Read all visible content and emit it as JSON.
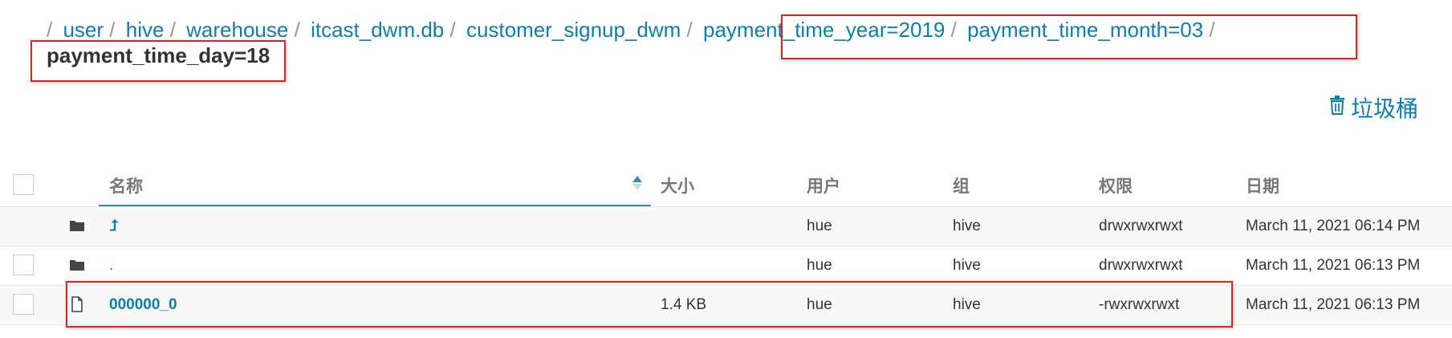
{
  "breadcrumb": {
    "items": [
      "user",
      "hive",
      "warehouse",
      "itcast_dwm.db",
      "customer_signup_dwm",
      "payment_time_year=2019",
      "payment_time_month=03"
    ],
    "separator": "/",
    "current": "payment_time_day=18"
  },
  "toolbar": {
    "trash_label": "垃圾桶",
    "trash_icon": "trash-icon"
  },
  "table": {
    "headers": {
      "name": "名称",
      "size": "大小",
      "user": "用户",
      "group": "组",
      "permissions": "权限",
      "date": "日期"
    },
    "rows": [
      {
        "icon": "folder-icon",
        "name": "⮥",
        "size": "",
        "user": "hue",
        "group": "hive",
        "permissions": "drwxrwxrwxt",
        "date": "March 11, 2021 06:14 PM"
      },
      {
        "icon": "folder-icon",
        "name": ".",
        "size": "",
        "user": "hue",
        "group": "hive",
        "permissions": "drwxrwxrwxt",
        "date": "March 11, 2021 06:13 PM"
      },
      {
        "icon": "file-icon",
        "name": "000000_0",
        "size": "1.4 KB",
        "user": "hue",
        "group": "hive",
        "permissions": "-rwxrwxrwxt",
        "date": "March 11, 2021 06:13 PM"
      }
    ]
  },
  "colors": {
    "link": "#0B7FAD",
    "highlight": "#dd2222",
    "sort_accent": "#338BB8"
  }
}
